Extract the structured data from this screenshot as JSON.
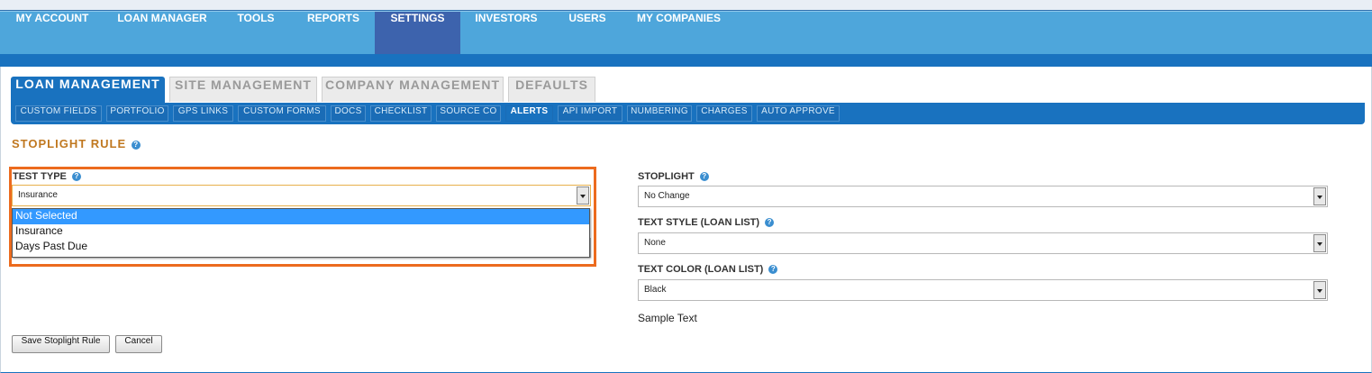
{
  "main_nav": [
    {
      "label": "MY ACCOUNT",
      "active": false
    },
    {
      "label": "LOAN MANAGER",
      "active": false
    },
    {
      "label": "TOOLS",
      "active": false
    },
    {
      "label": "REPORTS",
      "active": false
    },
    {
      "label": "SETTINGS",
      "active": true
    },
    {
      "label": "INVESTORS",
      "active": false
    },
    {
      "label": "USERS",
      "active": false
    },
    {
      "label": "MY COMPANIES",
      "active": false
    }
  ],
  "settings_tabs": [
    {
      "label": "LOAN MANAGEMENT",
      "active": true
    },
    {
      "label": "SITE MANAGEMENT",
      "active": false
    },
    {
      "label": "COMPANY MANAGEMENT",
      "active": false
    },
    {
      "label": "DEFAULTS",
      "active": false
    }
  ],
  "sub_nav": [
    {
      "label": "CUSTOM FIELDS",
      "active": false
    },
    {
      "label": "PORTFOLIO",
      "active": false
    },
    {
      "label": "GPS LINKS",
      "active": false
    },
    {
      "label": "CUSTOM FORMS",
      "active": false
    },
    {
      "label": "DOCS",
      "active": false
    },
    {
      "label": "CHECKLIST",
      "active": false
    },
    {
      "label": "SOURCE CO",
      "active": false
    },
    {
      "label": "ALERTS",
      "active": true
    },
    {
      "label": "API IMPORT",
      "active": false
    },
    {
      "label": "NUMBERING",
      "active": false
    },
    {
      "label": "CHARGES",
      "active": false
    },
    {
      "label": "AUTO APPROVE",
      "active": false
    }
  ],
  "section_title": "STOPLIGHT RULE",
  "form": {
    "test_type": {
      "label": "TEST TYPE",
      "value": "Insurance",
      "dropdown_open": true,
      "options": [
        "Not Selected",
        "Insurance",
        "Days Past Due"
      ],
      "highlighted_option": "Not Selected"
    },
    "stoplight": {
      "label": "STOPLIGHT",
      "value": "No Change"
    },
    "text_style": {
      "label": "TEXT STYLE (LOAN LIST)",
      "value": "None"
    },
    "text_color": {
      "label": "TEXT COLOR (LOAN LIST)",
      "value": "Black"
    },
    "sample_text": "Sample Text"
  },
  "buttons": {
    "save": "Save Stoplight Rule",
    "cancel": "Cancel"
  },
  "colors": {
    "nav_bg": "#4ea6db",
    "nav_active": "#3d63ad",
    "primary_blue": "#1972bf",
    "section_title": "#c07820",
    "highlight_border": "#ec6b1e",
    "option_selected": "#3399ff"
  },
  "icons": {
    "help": "help-icon",
    "select_arrow": "chevron-down-icon"
  }
}
